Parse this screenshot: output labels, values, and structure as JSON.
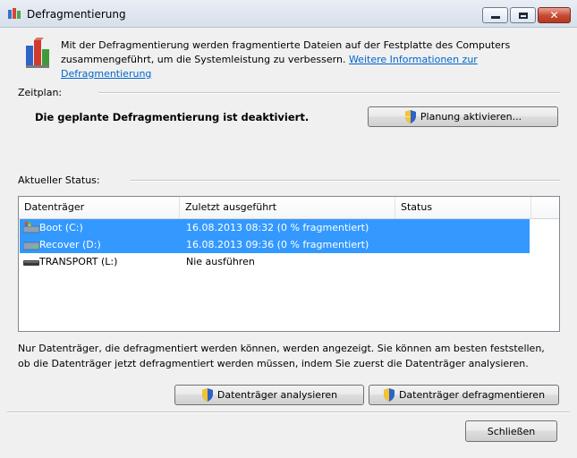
{
  "window": {
    "title": "Defragmentierung",
    "controls": {
      "minimize": "minimize",
      "maximize": "maximize",
      "close": "close"
    }
  },
  "intro": {
    "text": "Mit der Defragmentierung werden fragmentierte Dateien auf der Festplatte des Computers zusammengeführt, um die Systemleistung zu verbessern.",
    "link": "Weitere Informationen zur Defragmentierung"
  },
  "schedule": {
    "label": "Zeitplan:",
    "status": "Die geplante Defragmentierung ist deaktiviert.",
    "button": "Planung aktivieren..."
  },
  "current_status": {
    "label": "Aktueller Status:",
    "columns": [
      "Datenträger",
      "Zuletzt ausgeführt",
      "Status"
    ],
    "rows": [
      {
        "drive": "Boot (C:)",
        "last_run": "16.08.2013 08:32 (0 % fragmentiert)",
        "status": "",
        "selected": true,
        "icon": "windows-drive-icon"
      },
      {
        "drive": "Recover (D:)",
        "last_run": "16.08.2013 09:36 (0 % fragmentiert)",
        "status": "",
        "selected": true,
        "icon": "hard-drive-icon"
      },
      {
        "drive": "TRANSPORT (L:)",
        "last_run": "Nie ausführen",
        "status": "",
        "selected": false,
        "icon": "usb-drive-icon"
      }
    ]
  },
  "note": "Nur Datenträger, die defragmentiert werden können, werden angezeigt. Sie können am besten feststellen, ob die Datenträger jetzt defragmentiert werden müssen, indem Sie zuerst die Datenträger analysieren.",
  "buttons": {
    "analyze": "Datenträger analysieren",
    "defragment": "Datenträger defragmentieren",
    "close": "Schließen"
  },
  "colors": {
    "selection": "#3399ff",
    "link": "#0066cc",
    "background": "#f0f0f0"
  }
}
